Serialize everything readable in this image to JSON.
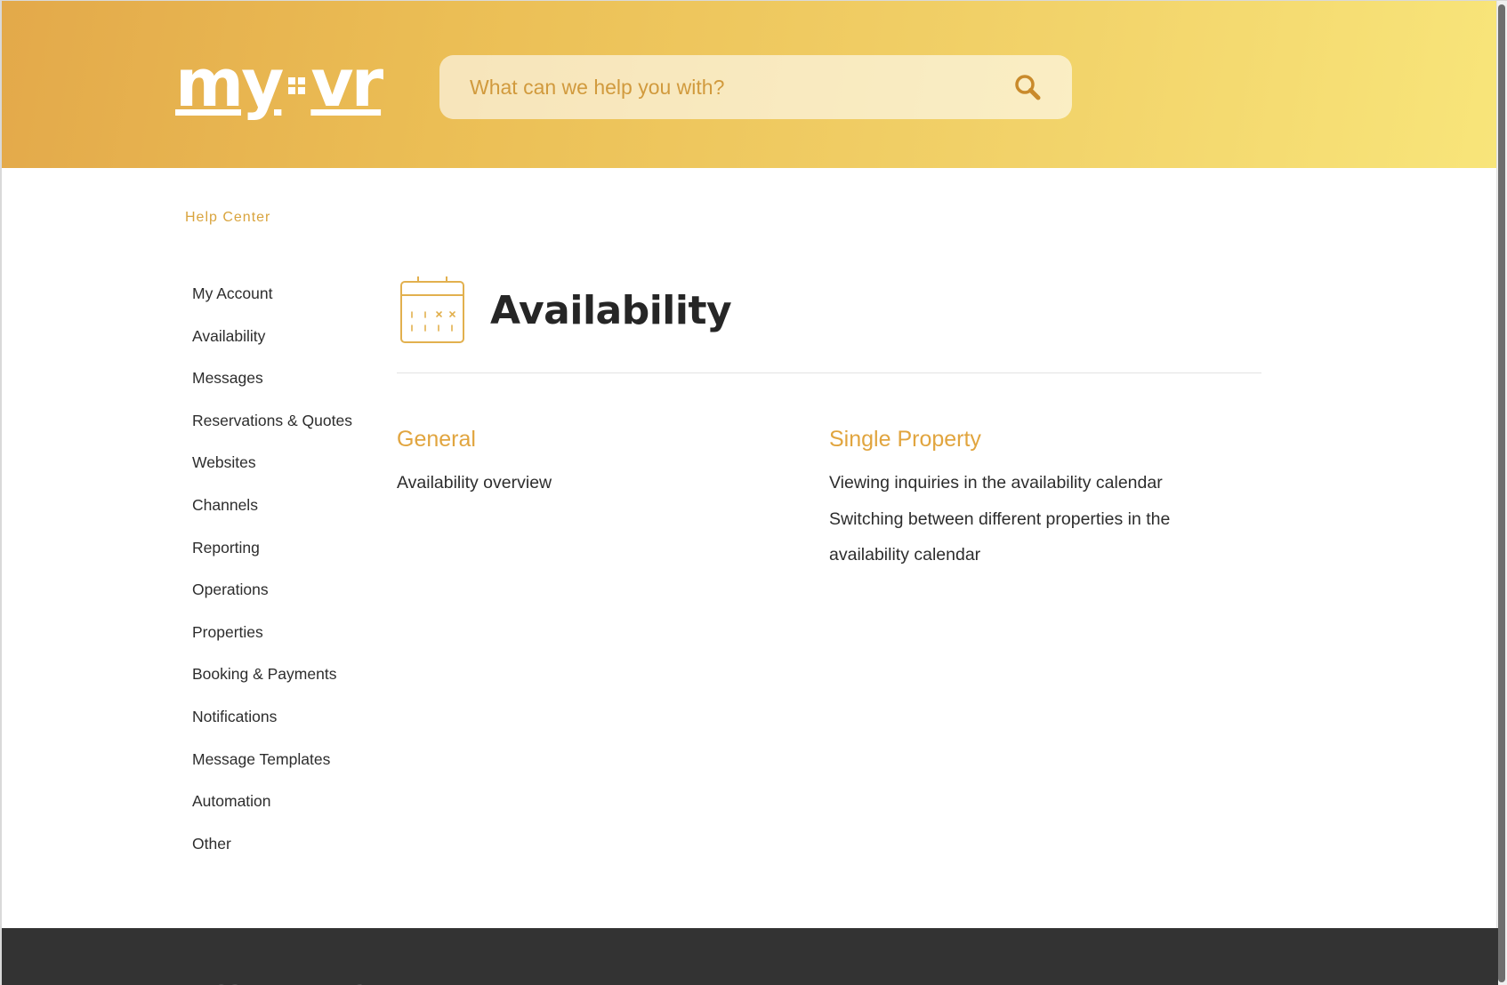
{
  "header": {
    "logo_left": "my",
    "logo_right": "vr",
    "search": {
      "placeholder": "What can we help you with?",
      "value": ""
    }
  },
  "breadcrumb": "Help Center",
  "sidebar": {
    "items": [
      {
        "label": "My Account"
      },
      {
        "label": "Availability"
      },
      {
        "label": "Messages"
      },
      {
        "label": "Reservations & Quotes"
      },
      {
        "label": "Websites"
      },
      {
        "label": "Channels"
      },
      {
        "label": "Reporting"
      },
      {
        "label": "Operations"
      },
      {
        "label": "Properties"
      },
      {
        "label": "Booking & Payments"
      },
      {
        "label": "Notifications"
      },
      {
        "label": "Message Templates"
      },
      {
        "label": "Automation"
      },
      {
        "label": "Other"
      }
    ]
  },
  "main": {
    "title": "Availability",
    "icon": "calendar-icon",
    "sections": [
      {
        "title": "General",
        "articles": [
          "Availability overview"
        ]
      },
      {
        "title": "Single Property",
        "articles": [
          "Viewing inquiries in the availability calendar",
          "Switching between different properties in the availability calendar"
        ]
      }
    ]
  },
  "footer": {
    "logo_left": "my",
    "logo_right": "vr"
  },
  "colors": {
    "accent": "#e1a53f",
    "header_gradient_start": "#e3a94a",
    "header_gradient_end": "#f8e57a",
    "footer": "#333333"
  }
}
